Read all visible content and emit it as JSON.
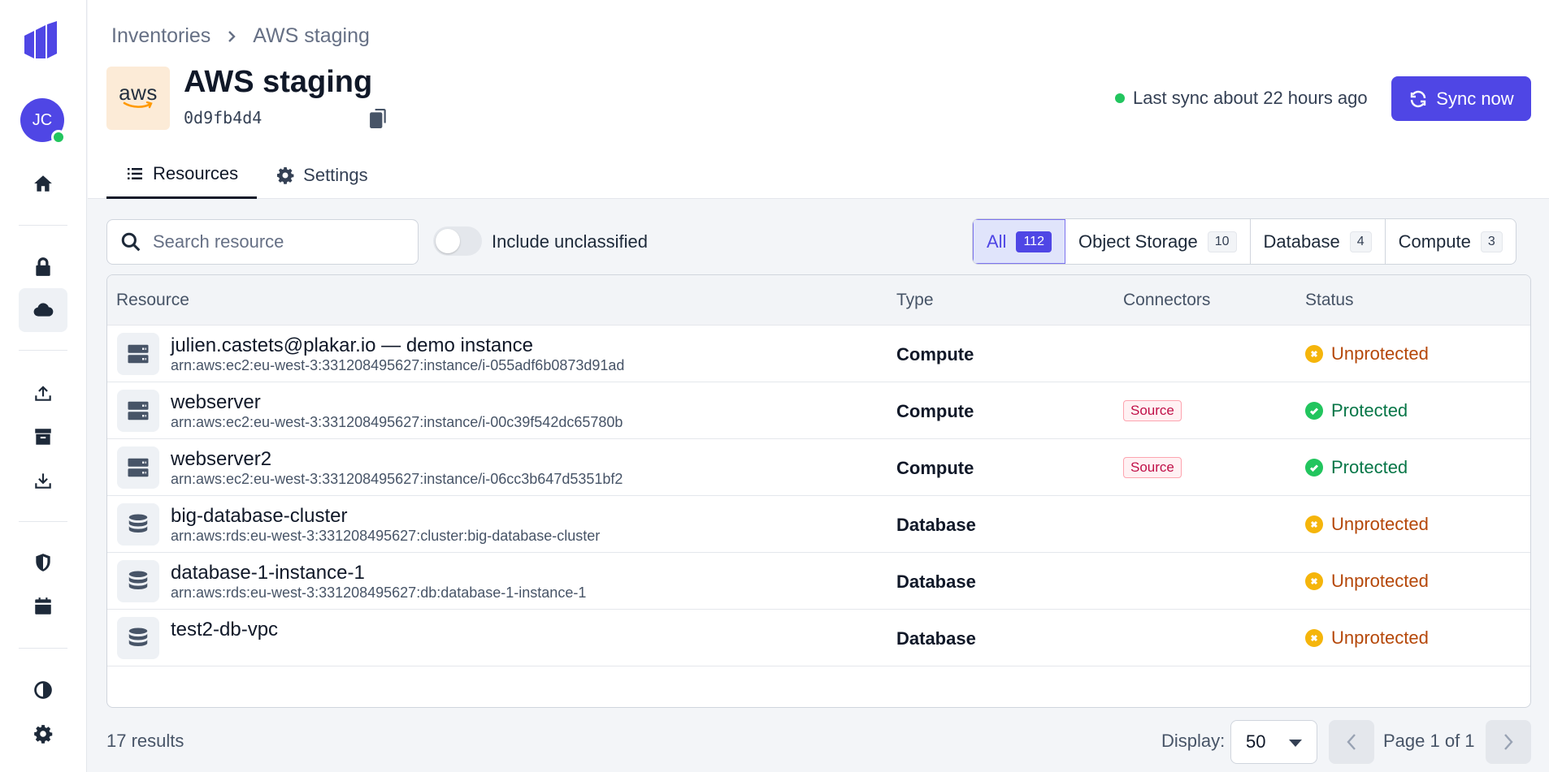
{
  "sidebar": {
    "avatar_initials": "JC",
    "items": [
      "home-icon",
      "lock-icon",
      "cloud-icon",
      "upload-icon",
      "archive-icon",
      "download-icon",
      "shield-icon",
      "calendar-icon",
      "theme-icon",
      "gear-icon"
    ],
    "active_item": "cloud-icon"
  },
  "breadcrumb": {
    "root": "Inventories",
    "current": "AWS staging"
  },
  "header": {
    "logo_text": "aws",
    "title": "AWS staging",
    "id": "0d9fb4d4",
    "sync_status": "Last sync about 22 hours ago",
    "sync_button": "Sync now"
  },
  "tabs": [
    {
      "label": "Resources",
      "icon": "list-icon",
      "active": true
    },
    {
      "label": "Settings",
      "icon": "gear-icon",
      "active": false
    }
  ],
  "filters": {
    "search_placeholder": "Search resource",
    "search_value": "",
    "include_unclassified_label": "Include unclassified",
    "include_unclassified": false,
    "segments": [
      {
        "label": "All",
        "count": "112",
        "active": true
      },
      {
        "label": "Object Storage",
        "count": "10",
        "active": false
      },
      {
        "label": "Database",
        "count": "4",
        "active": false
      },
      {
        "label": "Compute",
        "count": "3",
        "active": false
      }
    ]
  },
  "table": {
    "columns": [
      "Resource",
      "Type",
      "Connectors",
      "Status"
    ],
    "rows": [
      {
        "icon": "server-icon",
        "name": "julien.castets@plakar.io — demo instance",
        "arn": "arn:aws:ec2:eu-west-3:331208495627:instance/i-055adf6b0873d91ad",
        "type": "Compute",
        "connector": "",
        "status": "Unprotected"
      },
      {
        "icon": "server-icon",
        "name": "webserver",
        "arn": "arn:aws:ec2:eu-west-3:331208495627:instance/i-00c39f542dc65780b",
        "type": "Compute",
        "connector": "Source",
        "status": "Protected"
      },
      {
        "icon": "server-icon",
        "name": "webserver2",
        "arn": "arn:aws:ec2:eu-west-3:331208495627:instance/i-06cc3b647d5351bf2",
        "type": "Compute",
        "connector": "Source",
        "status": "Protected"
      },
      {
        "icon": "database-icon",
        "name": "big-database-cluster",
        "arn": "arn:aws:rds:eu-west-3:331208495627:cluster:big-database-cluster",
        "type": "Database",
        "connector": "",
        "status": "Unprotected"
      },
      {
        "icon": "database-icon",
        "name": "database-1-instance-1",
        "arn": "arn:aws:rds:eu-west-3:331208495627:db:database-1-instance-1",
        "type": "Database",
        "connector": "",
        "status": "Unprotected"
      },
      {
        "icon": "database-icon",
        "name": "test2-db-vpc",
        "arn": "",
        "type": "Database",
        "connector": "",
        "status": "Unprotected"
      }
    ]
  },
  "footer": {
    "results": "17 results",
    "display_label": "Display:",
    "display_value": "50",
    "page_text": "Page 1 of 1"
  },
  "colors": {
    "accent": "#4f46e5",
    "protected": "#067647",
    "unprotected": "#b54708"
  }
}
